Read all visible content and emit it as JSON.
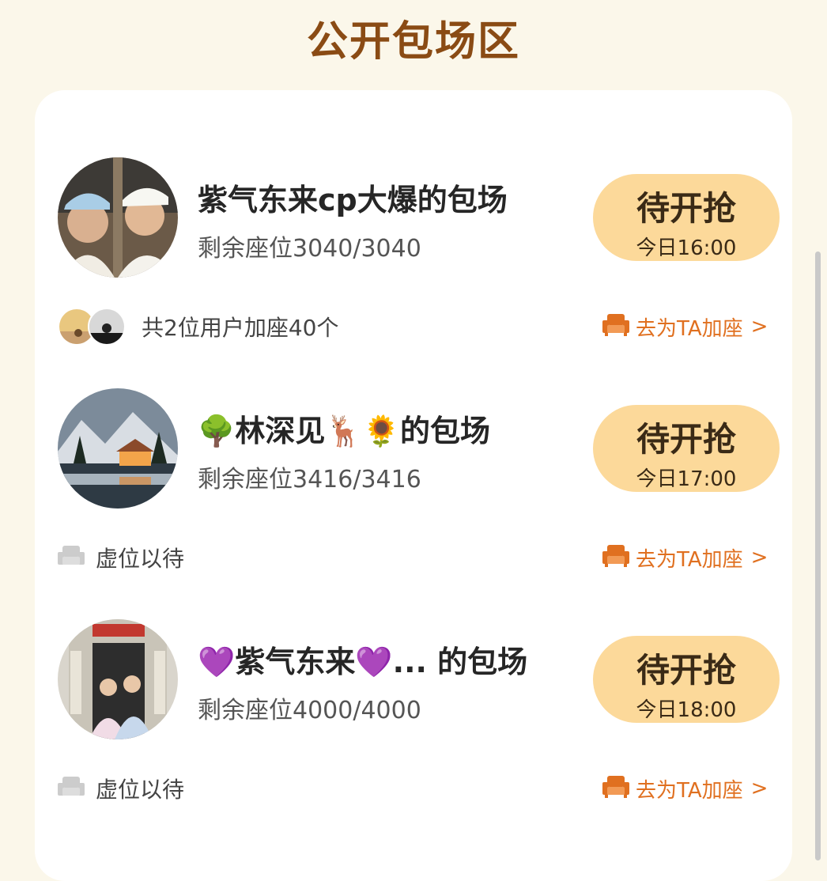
{
  "page": {
    "title": "公开包场区"
  },
  "rooms": [
    {
      "name": "紫气东来cp大爆的包场",
      "seats": "剩余座位3040/3040",
      "status": "待开抢",
      "time": "今日16:00",
      "footer_text": "共2位用户加座40个",
      "action": "去为TA加座",
      "chevron": ">"
    },
    {
      "name": "🌳林深见🦌🌻的包场",
      "seats": "剩余座位3416/3416",
      "status": "待开抢",
      "time": "今日17:00",
      "footer_text": "虚位以待",
      "action": "去为TA加座",
      "chevron": ">"
    },
    {
      "name": "💜紫气东来💜... 的包场",
      "seats": "剩余座位4000/4000",
      "status": "待开抢",
      "time": "今日18:00",
      "footer_text": "虚位以待",
      "action": "去为TA加座",
      "chevron": ">"
    }
  ],
  "colors": {
    "background": "#fbf7ea",
    "card": "#ffffff",
    "title": "#8a4b14",
    "button": "#fcd99a",
    "accent": "#e07020",
    "seat_empty": "#cccccc"
  },
  "icons": {
    "add_seat": "sofa-icon",
    "empty_seat": "empty-seat-icon"
  }
}
